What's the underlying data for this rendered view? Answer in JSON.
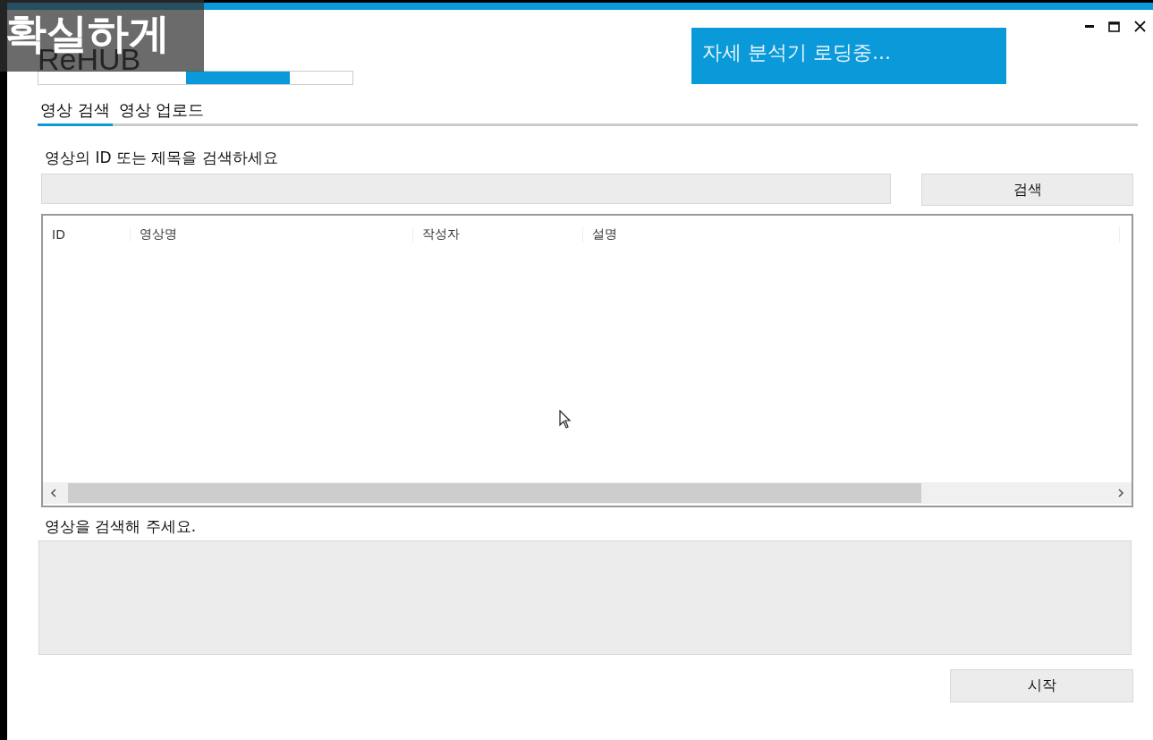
{
  "caption": "확실하게",
  "logo": "ReHUB",
  "loading": "자세 분석기 로딩중...",
  "tabs": [
    {
      "label": "영상 검색",
      "selected": true
    },
    {
      "label": "영상 업로드",
      "selected": false
    }
  ],
  "search": {
    "label": "영상의 ID 또는 제목을 검색하세요",
    "button": "검색"
  },
  "table": {
    "columns": [
      "ID",
      "영상명",
      "작성자",
      "설명"
    ]
  },
  "status": "영상을 검색해 주세요.",
  "start_button": "시작"
}
